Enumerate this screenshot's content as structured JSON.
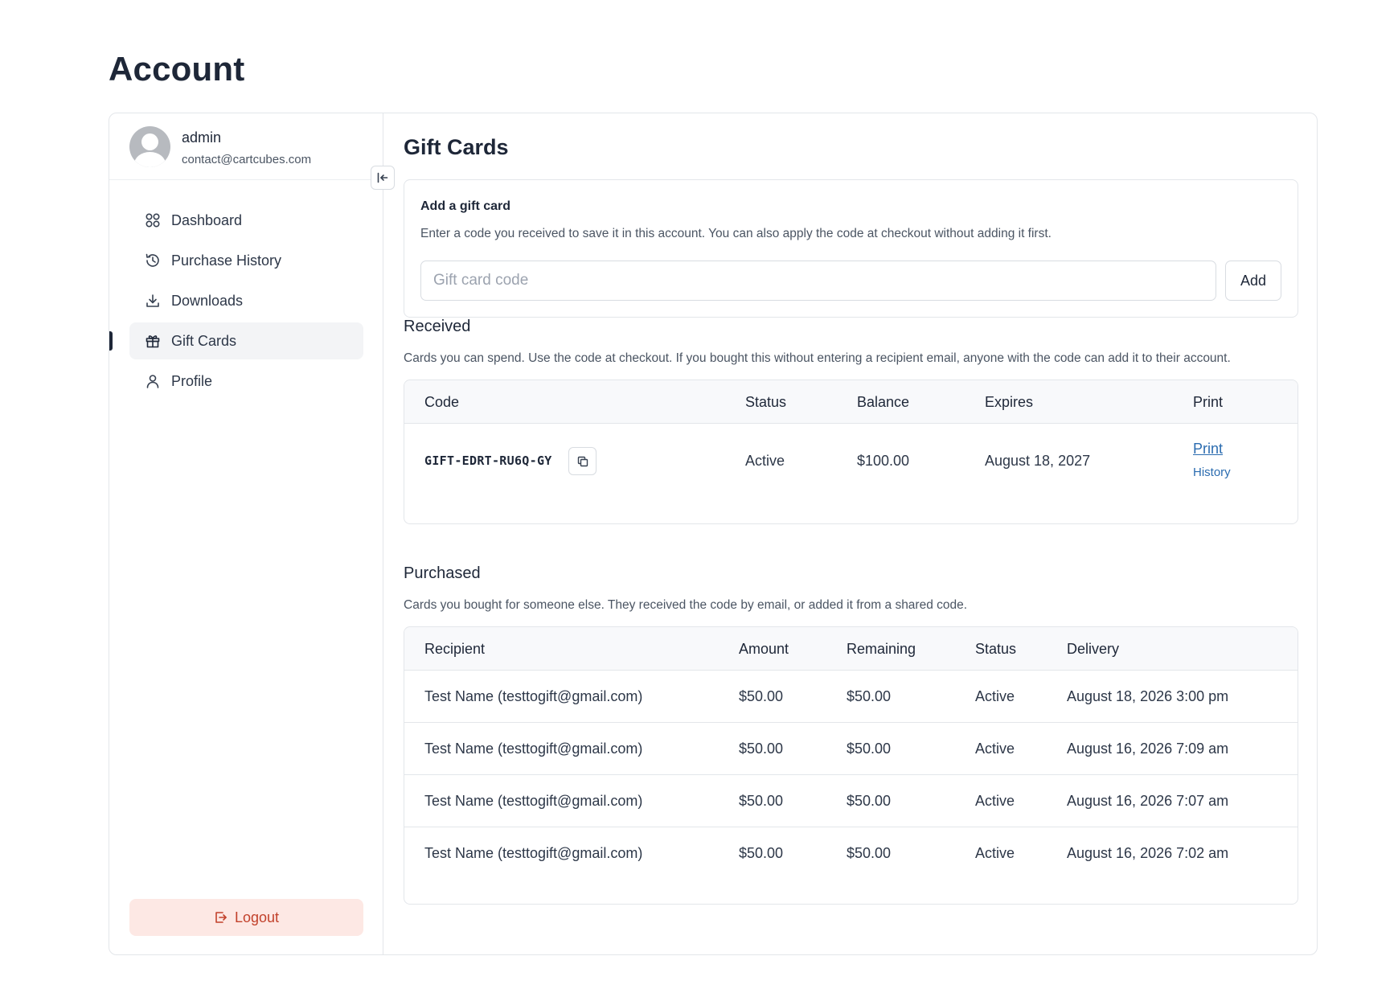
{
  "page": {
    "title": "Account"
  },
  "user": {
    "name": "admin",
    "email": "contact@cartcubes.com"
  },
  "nav": {
    "items": [
      {
        "label": "Dashboard",
        "icon": "dashboard-grid-icon"
      },
      {
        "label": "Purchase History",
        "icon": "history-icon"
      },
      {
        "label": "Downloads",
        "icon": "download-icon"
      },
      {
        "label": "Gift Cards",
        "icon": "gift-icon",
        "active": true
      },
      {
        "label": "Profile",
        "icon": "user-icon"
      }
    ],
    "logout_label": "Logout"
  },
  "main": {
    "title": "Gift Cards"
  },
  "add_card": {
    "title": "Add a gift card",
    "description": "Enter a code you received to save it in this account. You can also apply the code at checkout without adding it first.",
    "input_placeholder": "Gift card code",
    "input_value": "",
    "button_label": "Add"
  },
  "received": {
    "title": "Received",
    "description": "Cards you can spend. Use the code at checkout. If you bought this without entering a recipient email, anyone with the code can add it to their account.",
    "columns": [
      "Code",
      "Status",
      "Balance",
      "Expires",
      "Print"
    ],
    "rows": [
      {
        "code": "GIFT-EDRT-RU6Q-GY",
        "status": "Active",
        "balance": "$100.00",
        "expires": "August 18, 2027",
        "print_label": "Print",
        "history_label": "History"
      }
    ]
  },
  "purchased": {
    "title": "Purchased",
    "description": "Cards you bought for someone else. They received the code by email, or added it from a shared code.",
    "columns": [
      "Recipient",
      "Amount",
      "Remaining",
      "Status",
      "Delivery"
    ],
    "rows": [
      {
        "recipient": "Test Name (testtogift@gmail.com)",
        "amount": "$50.00",
        "remaining": "$50.00",
        "status": "Active",
        "delivery": "August 18, 2026 3:00 pm"
      },
      {
        "recipient": "Test Name (testtogift@gmail.com)",
        "amount": "$50.00",
        "remaining": "$50.00",
        "status": "Active",
        "delivery": "August 16, 2026 7:09 am"
      },
      {
        "recipient": "Test Name (testtogift@gmail.com)",
        "amount": "$50.00",
        "remaining": "$50.00",
        "status": "Active",
        "delivery": "August 16, 2026 7:07 am"
      },
      {
        "recipient": "Test Name (testtogift@gmail.com)",
        "amount": "$50.00",
        "remaining": "$50.00",
        "status": "Active",
        "delivery": "August 16, 2026 7:02 am"
      }
    ]
  },
  "colors": {
    "text_primary": "#1e2738",
    "link": "#2b6cb0",
    "logout_bg": "#fde8e4",
    "logout_text": "#c2412b",
    "border": "#e3e6ea"
  }
}
